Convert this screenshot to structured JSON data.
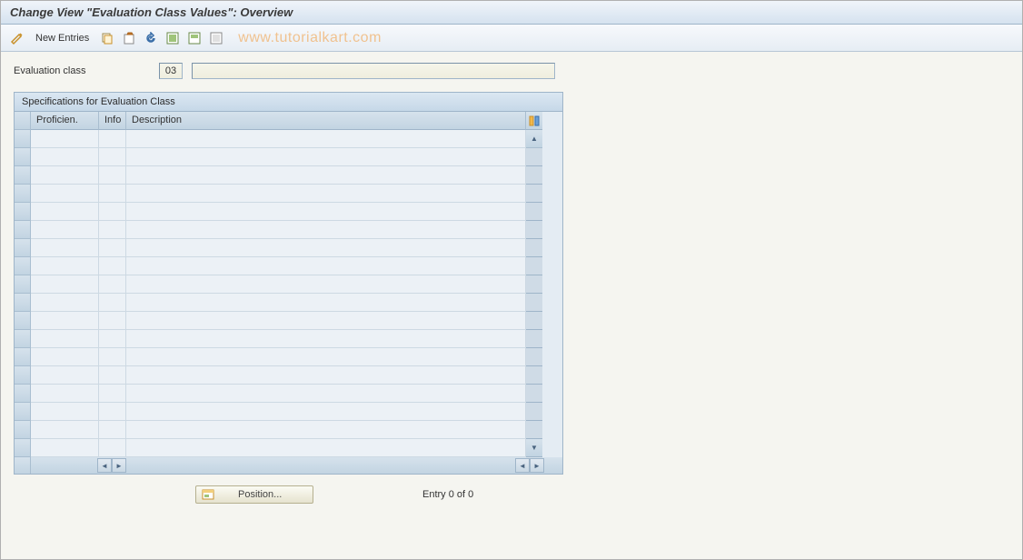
{
  "title": "Change View \"Evaluation Class Values\": Overview",
  "watermark": "www.tutorialkart.com",
  "toolbar": {
    "new_entries_label": "New Entries"
  },
  "fields": {
    "evaluation_class_label": "Evaluation class",
    "evaluation_class_value": "03",
    "evaluation_class_desc": ""
  },
  "table": {
    "panel_title": "Specifications for Evaluation Class",
    "columns": {
      "proficiency": "Proficien.",
      "info": "Info",
      "description": "Description"
    },
    "rows": [
      {
        "proficiency": "",
        "info": "",
        "description": ""
      },
      {
        "proficiency": "",
        "info": "",
        "description": ""
      },
      {
        "proficiency": "",
        "info": "",
        "description": ""
      },
      {
        "proficiency": "",
        "info": "",
        "description": ""
      },
      {
        "proficiency": "",
        "info": "",
        "description": ""
      },
      {
        "proficiency": "",
        "info": "",
        "description": ""
      },
      {
        "proficiency": "",
        "info": "",
        "description": ""
      },
      {
        "proficiency": "",
        "info": "",
        "description": ""
      },
      {
        "proficiency": "",
        "info": "",
        "description": ""
      },
      {
        "proficiency": "",
        "info": "",
        "description": ""
      },
      {
        "proficiency": "",
        "info": "",
        "description": ""
      },
      {
        "proficiency": "",
        "info": "",
        "description": ""
      },
      {
        "proficiency": "",
        "info": "",
        "description": ""
      },
      {
        "proficiency": "",
        "info": "",
        "description": ""
      },
      {
        "proficiency": "",
        "info": "",
        "description": ""
      },
      {
        "proficiency": "",
        "info": "",
        "description": ""
      },
      {
        "proficiency": "",
        "info": "",
        "description": ""
      },
      {
        "proficiency": "",
        "info": "",
        "description": ""
      }
    ]
  },
  "footer": {
    "position_label": "Position...",
    "entry_text": "Entry 0 of 0"
  }
}
